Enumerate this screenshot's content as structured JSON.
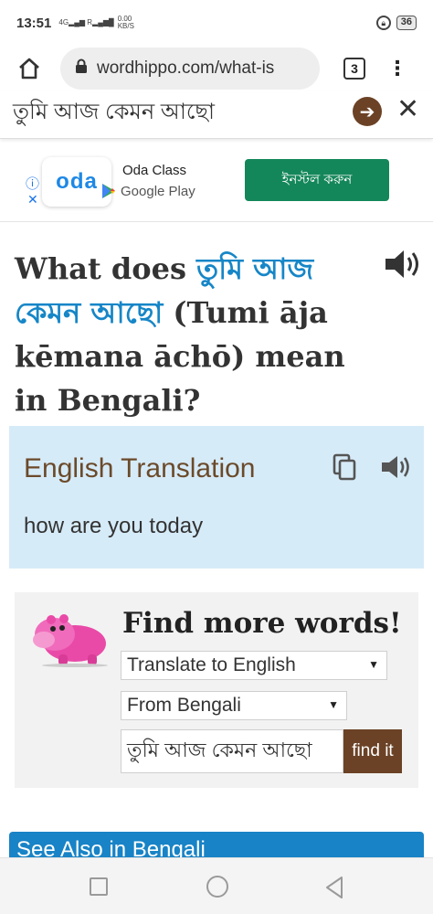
{
  "status_bar": {
    "time": "13:51",
    "signal1": "4G",
    "signal2": "R",
    "speed_value": "0.00",
    "speed_unit": "KB/S",
    "battery": "36"
  },
  "browser": {
    "url": "wordhippo.com/what-is",
    "tab_count": "3"
  },
  "search": {
    "query": "তুমি আজ কেমন আছো"
  },
  "ad": {
    "logo_text": "oda",
    "title": "Oda Class",
    "store": "Google Play",
    "install_label": "ইনস্টল করুন",
    "install_color": "#14875a"
  },
  "heading": {
    "prefix": "What does ",
    "bengali": "তুমি আজ কেমন আছো",
    "suffix": " (Tumi āja kēmana āchō) mean in Bengali?",
    "accent_color": "#1686c7"
  },
  "translation": {
    "label": "English Translation",
    "value": "how are you today",
    "bg_color": "#d6ebf8"
  },
  "find_more": {
    "title": "Find more words!",
    "translate_select": "Translate to English",
    "from_select": "From Bengali",
    "input_value": "তুমি আজ কেমন আছো",
    "button_label": "find it",
    "button_color": "#6b4226"
  },
  "see_also": {
    "label": "See Also in Bengali"
  },
  "icons": {
    "home": "home-icon",
    "lock": "lock-icon",
    "menu": "more-vert-icon",
    "speaker": "speaker-icon",
    "copy": "copy-icon",
    "go": "arrow-right-icon",
    "close": "close-icon"
  }
}
